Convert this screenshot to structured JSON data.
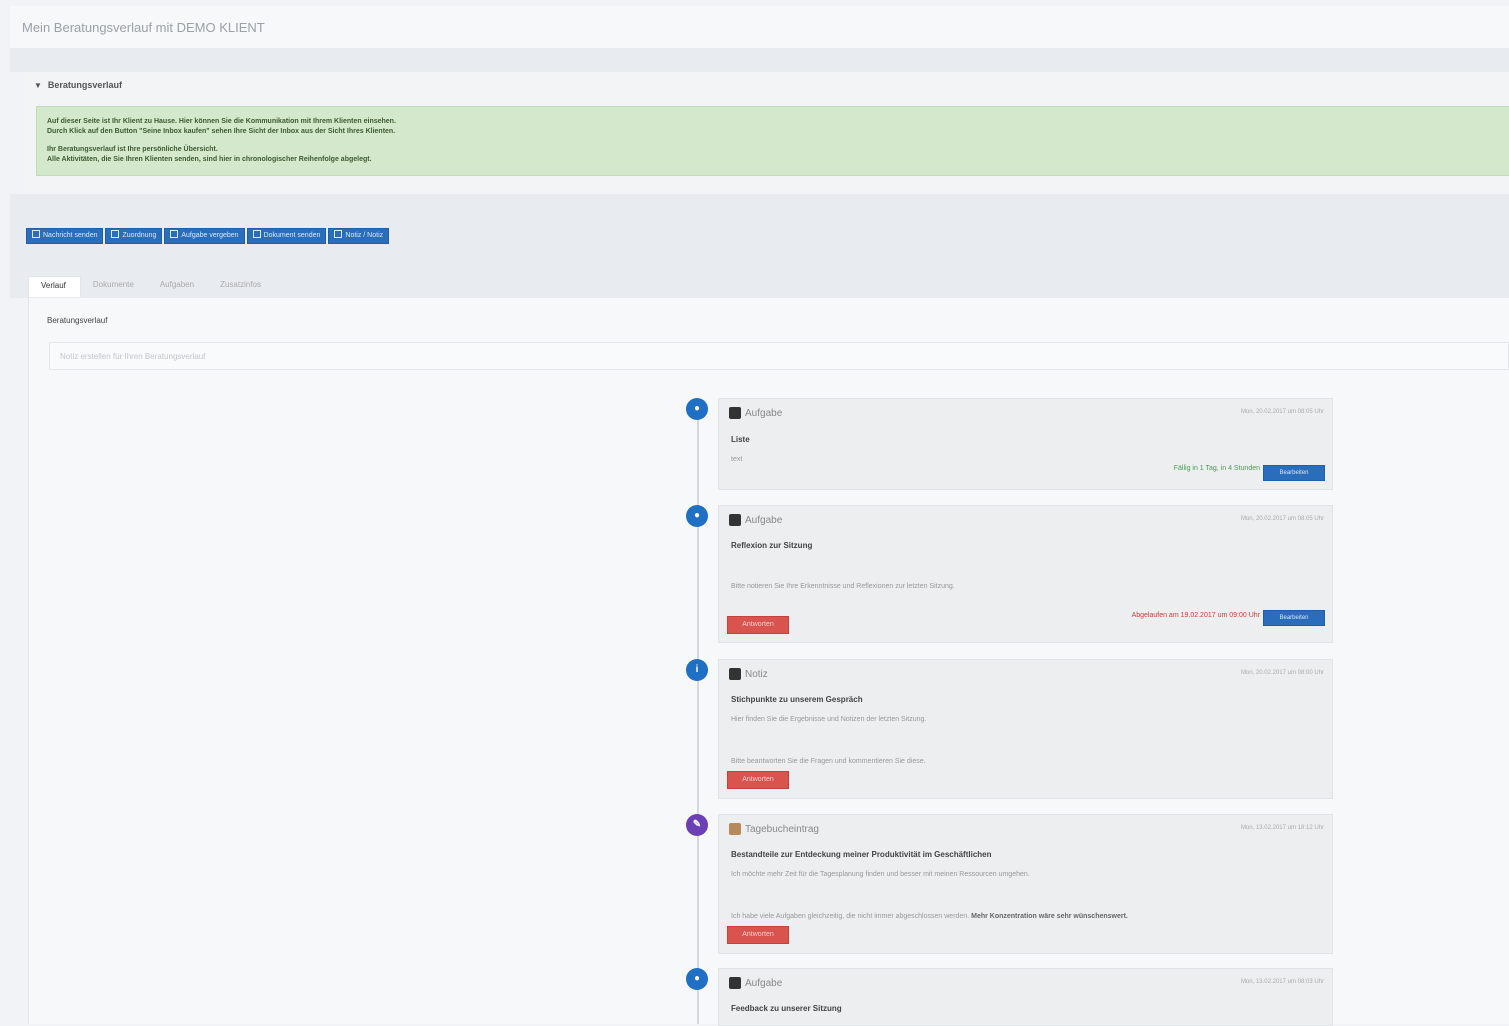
{
  "page_title": "Mein Beratungsverlauf mit DEMO KLIENT",
  "info_panel": {
    "header": "Beratungsverlauf",
    "lines": [
      "Auf dieser Seite ist Ihr Klient zu Hause. Hier können Sie die Kommunikation mit Ihrem Klienten einsehen.",
      "Durch Klick auf den Button \"Seine Inbox kaufen\" sehen Ihre Sicht der Inbox aus der Sicht Ihres Klienten.",
      "Ihr Beratungsverlauf ist Ihre persönliche Übersicht.",
      "Alle Aktivitäten, die Sie Ihren Klienten senden, sind hier in chronologischer Reihenfolge abgelegt."
    ]
  },
  "toolbar_buttons": [
    "Nachricht senden",
    "Zuordnung",
    "Aufgabe vergeben",
    "Dokument senden",
    "Notiz / Notiz"
  ],
  "tabs": [
    "Verlauf",
    "Dokumente",
    "Aufgaben",
    "Zusatzinfos"
  ],
  "notes": {
    "label": "Beratungsverlauf",
    "placeholder": "Notiz erstellen für Ihren Beratungsverlauf"
  },
  "timeline": [
    {
      "icon": "chat",
      "color": "#1f6fc5",
      "type": "Aufgabe",
      "date": "Mon, 20.02.2017 um 08:05 Uhr",
      "title": "Liste",
      "text": "text",
      "status": "Fällig in 1 Tag, in 4 Stunden",
      "status_color": "green",
      "action_label": "Bearbeiten"
    },
    {
      "icon": "chat",
      "color": "#1f6fc5",
      "type": "Aufgabe",
      "date": "Mon, 20.02.2017 um 08:05 Uhr",
      "title": "Reflexion zur Sitzung",
      "text": "Bitte notieren Sie Ihre Erkenntnisse und Reflexionen zur letzten Sitzung.",
      "reply_label": "Antworten",
      "status": "Abgelaufen am 19.02.2017 um 09:00 Uhr",
      "status_color": "red",
      "action_label": "Bearbeiten"
    },
    {
      "icon": "info",
      "color": "#1f6fc5",
      "type": "Notiz",
      "date": "Mon, 20.02.2017 um 08:00 Uhr",
      "title": "Stichpunkte zu unserem Gespräch",
      "text": "Hier finden Sie die Ergebnisse und Notizen der letzten Sitzung.",
      "text2": "Bitte beantworten Sie die Fragen und kommentieren Sie diese.",
      "reply_label": "Antworten"
    },
    {
      "icon": "pen",
      "color": "#6b3fb5",
      "type": "Tagebucheintrag",
      "date": "Mon, 13.02.2017 um 18:12 Uhr",
      "title": "Bestandteile zur Entdeckung meiner Produktivität im Geschäftlichen",
      "text": "Ich möchte mehr Zeit für die Tagesplanung finden und besser mit meinen Ressourcen umgehen.",
      "text2": "Ich habe viele Aufgaben gleichzeitig, die nicht immer abgeschlossen werden.",
      "text2_bold": "Mehr Konzentration wäre sehr wünschenswert.",
      "reply_label": "Antworten"
    },
    {
      "icon": "chat",
      "color": "#1f6fc5",
      "type": "Aufgabe",
      "date": "Mon, 13.02.2017 um 08:03 Uhr",
      "title": "Feedback zu unserer Sitzung"
    }
  ]
}
